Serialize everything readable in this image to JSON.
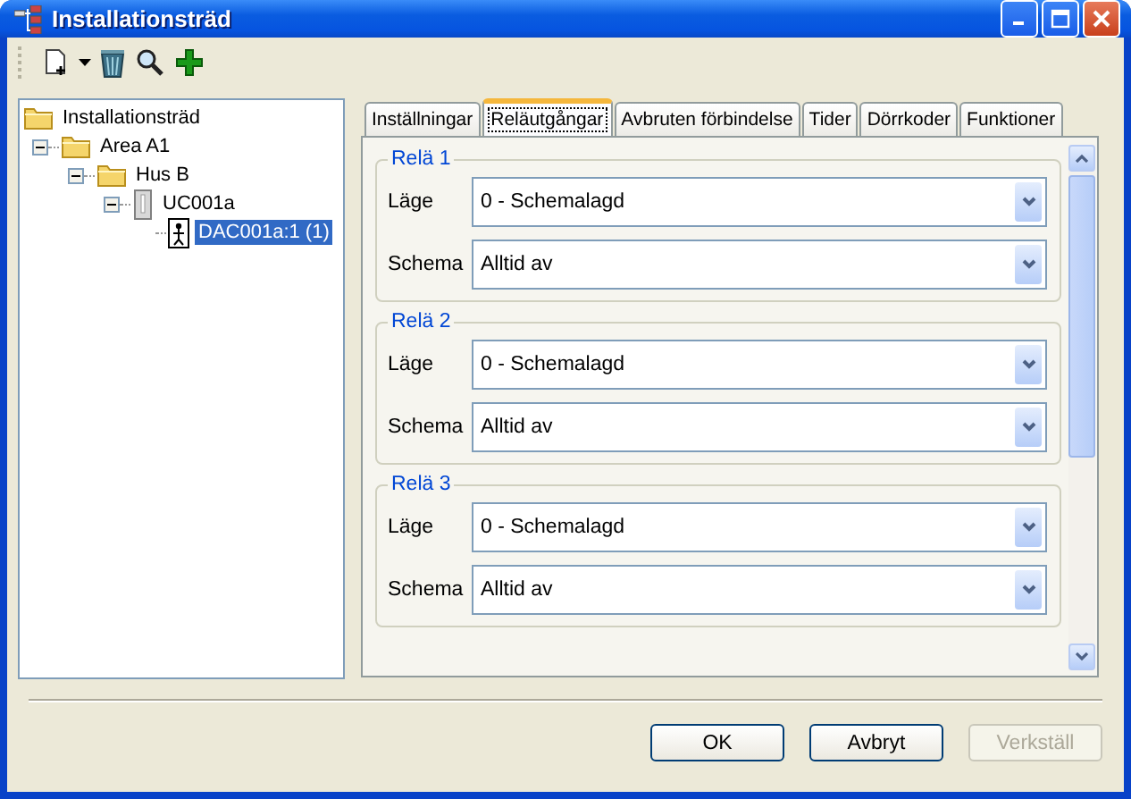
{
  "window": {
    "title": "Installationsträd"
  },
  "tree": [
    {
      "label": "Installationsträd",
      "kind": "folder",
      "selected": false,
      "children": [
        {
          "label": "Area A1",
          "kind": "folder",
          "selected": false,
          "expanded": true,
          "children": [
            {
              "label": "Hus B",
              "kind": "folder",
              "selected": false,
              "expanded": true,
              "children": [
                {
                  "label": "UC001a",
                  "kind": "controller",
                  "selected": false,
                  "expanded": true,
                  "children": [
                    {
                      "label": "DAC001a:1 (1)",
                      "kind": "door",
                      "selected": true
                    }
                  ]
                }
              ]
            }
          ]
        }
      ]
    }
  ],
  "tabs": [
    {
      "label": "Inställningar",
      "selected": false
    },
    {
      "label": "Reläutgångar",
      "selected": true
    },
    {
      "label": "Avbruten förbindelse",
      "selected": false
    },
    {
      "label": "Tider",
      "selected": false
    },
    {
      "label": "Dörrkoder",
      "selected": false
    },
    {
      "label": "Funktioner",
      "selected": false
    }
  ],
  "relays": [
    {
      "title": "Relä 1",
      "fields": [
        {
          "label": "Läge",
          "value": "0 - Schemalagd"
        },
        {
          "label": "Schema",
          "value": "Alltid av"
        }
      ]
    },
    {
      "title": "Relä 2",
      "fields": [
        {
          "label": "Läge",
          "value": "0 - Schemalagd"
        },
        {
          "label": "Schema",
          "value": "Alltid av"
        }
      ]
    },
    {
      "title": "Relä 3",
      "fields": [
        {
          "label": "Läge",
          "value": "0 - Schemalagd"
        },
        {
          "label": "Schema",
          "value": "Alltid av"
        }
      ]
    }
  ],
  "buttons": [
    {
      "label": "OK",
      "disabled": false
    },
    {
      "label": "Avbryt",
      "disabled": false
    },
    {
      "label": "Verkställ",
      "disabled": true
    }
  ]
}
